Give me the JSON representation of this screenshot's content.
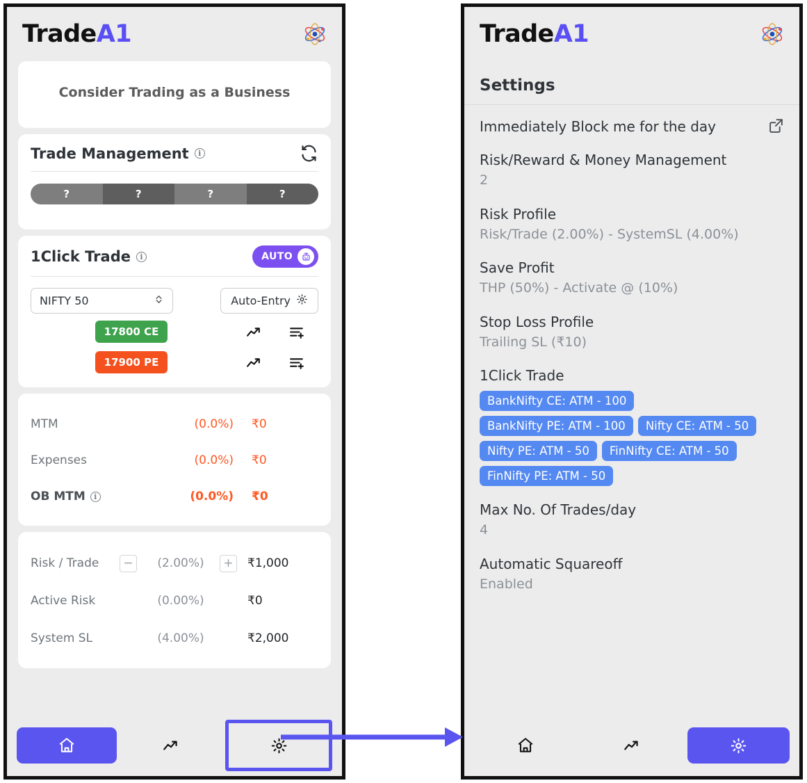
{
  "brand": {
    "part1": "Trade",
    "part2": "A1",
    "logo_icon": "atom-icon"
  },
  "left_panel": {
    "quote": "Consider Trading as a Business",
    "trade_management": {
      "title": "Trade Management",
      "info_icon": "info-circle-icon",
      "refresh_icon": "refresh-icon",
      "segments": [
        "?",
        "?",
        "?",
        "?"
      ]
    },
    "one_click_trade": {
      "title": "1Click Trade",
      "info_icon": "info-circle-icon",
      "auto_badge": "AUTO",
      "robot_icon": "robot-icon",
      "instrument": "NIFTY 50",
      "auto_entry_label": "Auto-Entry",
      "auto_entry_icon": "gear-icon",
      "rows": [
        {
          "strike": "17800 CE",
          "color": "#3fa34d",
          "chart_icon": "trend-up-icon",
          "order_icon": "add-to-list-icon"
        },
        {
          "strike": "17900 PE",
          "color": "#f4511e",
          "chart_icon": "trend-up-icon",
          "order_icon": "add-to-list-icon"
        }
      ]
    },
    "mtm": [
      {
        "label": "MTM",
        "percent": "(0.0%)",
        "value": "₹0",
        "bold": false,
        "info": false
      },
      {
        "label": "Expenses",
        "percent": "(0.0%)",
        "value": "₹0",
        "bold": false,
        "info": false
      },
      {
        "label": "OB MTM",
        "percent": "(0.0%)",
        "value": "₹0",
        "bold": true,
        "info": true
      }
    ],
    "risk": [
      {
        "label": "Risk / Trade",
        "percent": "(2.00%)",
        "value": "₹1,000",
        "steppers": true,
        "minus": "−",
        "plus": "+"
      },
      {
        "label": "Active Risk",
        "percent": "(0.00%)",
        "value": "₹0",
        "steppers": false
      },
      {
        "label": "System SL",
        "percent": "(4.00%)",
        "value": "₹2,000",
        "steppers": false
      }
    ],
    "nav": [
      {
        "icon": "home-icon",
        "active": true,
        "highlight": false
      },
      {
        "icon": "trend-up-icon",
        "active": false,
        "highlight": false
      },
      {
        "icon": "gear-icon",
        "active": false,
        "highlight": true
      }
    ]
  },
  "right_panel": {
    "settings_title": "Settings",
    "items": [
      {
        "title": "Immediately Block me for the day",
        "sub": "",
        "action_icon": "external-link-icon"
      },
      {
        "title": "Risk/Reward & Money Management",
        "sub": "2"
      },
      {
        "title": "Risk Profile",
        "sub": "Risk/Trade (2.00%) - SystemSL (4.00%)"
      },
      {
        "title": "Save Profit",
        "sub": "THP (50%) - Activate @ (10%)"
      },
      {
        "title": "Stop Loss Profile",
        "sub": "Trailing SL (₹10)"
      },
      {
        "title": "1Click Trade",
        "sub": "",
        "chips": [
          "BankNifty CE: ATM - 100",
          "BankNifty PE: ATM - 100",
          "Nifty CE: ATM - 50",
          "Nifty PE: ATM - 50",
          "FinNifty CE: ATM - 50",
          "FinNifty PE: ATM - 50"
        ]
      },
      {
        "title": "Max No. Of Trades/day",
        "sub": "4"
      },
      {
        "title": "Automatic Squareoff",
        "sub": "Enabled"
      }
    ],
    "nav": [
      {
        "icon": "home-icon",
        "active": false,
        "highlight": false
      },
      {
        "icon": "trend-up-icon",
        "active": false,
        "highlight": false
      },
      {
        "icon": "gear-icon",
        "active": true,
        "highlight": false
      }
    ]
  },
  "connector": {
    "icon": "arrow-right-icon",
    "color": "#5b55f0"
  },
  "colors": {
    "background": "#ececec",
    "card": "#ffffff",
    "accent_purple": "#5b55f0",
    "auto_purple": "#7b4ff0",
    "chip_blue": "#5589f2",
    "ce_green": "#3fa34d",
    "pe_orange": "#f4511e",
    "red": "#ff5722",
    "muted": "#8b9097"
  }
}
